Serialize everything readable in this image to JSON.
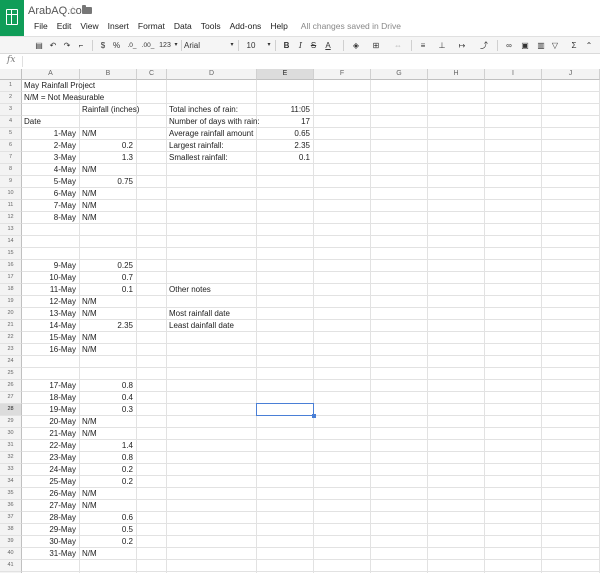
{
  "header": {
    "watermark": "ArabAQ.com",
    "menu": [
      "File",
      "Edit",
      "View",
      "Insert",
      "Format",
      "Data",
      "Tools",
      "Add-ons",
      "Help"
    ],
    "save_status": "All changes saved in Drive",
    "brand_color": "#0f9d58"
  },
  "toolbar": {
    "print_icon": "printer-icon",
    "undo_icon": "undo-icon",
    "redo_icon": "redo-icon",
    "paint_format_icon": "paint-format-icon",
    "currency": "$",
    "percent": "%",
    "decrease_decimals": ".0_",
    "increase_decimals": ".00_",
    "more_formats": "123",
    "font": "Arial",
    "font_size": "10",
    "bold": "B",
    "italic": "I",
    "strikethrough": "S",
    "text_color": "A",
    "sum_icon": "Σ"
  },
  "formula_bar": {
    "label": "fx",
    "value": ""
  },
  "grid": {
    "columns": [
      "A",
      "B",
      "C",
      "D",
      "E",
      "F",
      "G",
      "H",
      "I",
      "J"
    ],
    "rows": [
      "1",
      "2",
      "3",
      "4",
      "5",
      "6",
      "7",
      "8",
      "9",
      "10",
      "11",
      "12",
      "13",
      "14",
      "15",
      "16",
      "17",
      "18",
      "19",
      "20",
      "21",
      "22",
      "23",
      "24",
      "25",
      "26",
      "27",
      "28",
      "29",
      "30",
      "31",
      "32",
      "33",
      "34",
      "35",
      "36",
      "37",
      "38",
      "39",
      "40",
      "41",
      "42"
    ],
    "selected_cell": "E28",
    "cells": {
      "A1": "May Rainfall Project",
      "A2": "N/M = Not Measurable",
      "B3": "Rainfall (inches)",
      "A4": "Date",
      "D3": "Total inches of rain:",
      "E3": "11:05",
      "D4": "Number of days with rain:",
      "E4": "17",
      "D5": "Average rainfall amount",
      "E5": "0.65",
      "D6": "Largest rainfall:",
      "E6": "2.35",
      "D7": "Smallest rainfall:",
      "E7": "0.1",
      "A5": "1-May",
      "B5": "N/M",
      "A6": "2-May",
      "B6": "0.2",
      "A7": "3-May",
      "B7": "1.3",
      "A8": "4-May",
      "B8": "N/M",
      "A9": "5-May",
      "B9": "0.75",
      "A10": "6-May",
      "B10": "N/M",
      "A11": "7-May",
      "B11": "N/M",
      "A12": "8-May",
      "B12": "N/M",
      "A16": "9-May",
      "B16": "0.25",
      "A17": "10-May",
      "B17": "0.7",
      "A18": "11-May",
      "B18": "0.1",
      "D18": "Other notes",
      "A19": "12-May",
      "B19": "N/M",
      "A20": "13-May",
      "B20": "N/M",
      "D20": "Most rainfall date",
      "A21": "14-May",
      "B21": "2.35",
      "D21": "Least dainfall date",
      "A22": "15-May",
      "B22": "N/M",
      "A23": "16-May",
      "B23": "N/M",
      "A26": "17-May",
      "B26": "0.8",
      "A27": "18-May",
      "B27": "0.4",
      "A28": "19-May",
      "B28": "0.3",
      "A29": "20-May",
      "B29": "N/M",
      "A30": "21-May",
      "B30": "N/M",
      "A31": "22-May",
      "B31": "1.4",
      "A32": "23-May",
      "B32": "0.8",
      "A33": "24-May",
      "B33": "0.2",
      "A34": "25-May",
      "B34": "0.2",
      "A35": "26-May",
      "B35": "N/M",
      "A36": "27-May",
      "B36": "N/M",
      "A37": "28-May",
      "B37": "0.6",
      "A38": "29-May",
      "B38": "0.5",
      "A39": "30-May",
      "B39": "0.2",
      "A40": "31-May",
      "B40": "N/M"
    },
    "right_aligned": [
      "A5",
      "A6",
      "A7",
      "A8",
      "A9",
      "A10",
      "A11",
      "A12",
      "A16",
      "A17",
      "A18",
      "A19",
      "A20",
      "A21",
      "A22",
      "A23",
      "A26",
      "A27",
      "A28",
      "A29",
      "A30",
      "A31",
      "A32",
      "A33",
      "A34",
      "A35",
      "A36",
      "A37",
      "A38",
      "A39",
      "A40",
      "B6",
      "B7",
      "B9",
      "B16",
      "B17",
      "B18",
      "B21",
      "B26",
      "B27",
      "B28",
      "B31",
      "B32",
      "B33",
      "B34",
      "B37",
      "B38",
      "B39",
      "E3",
      "E4",
      "E5",
      "E6",
      "E7"
    ]
  }
}
